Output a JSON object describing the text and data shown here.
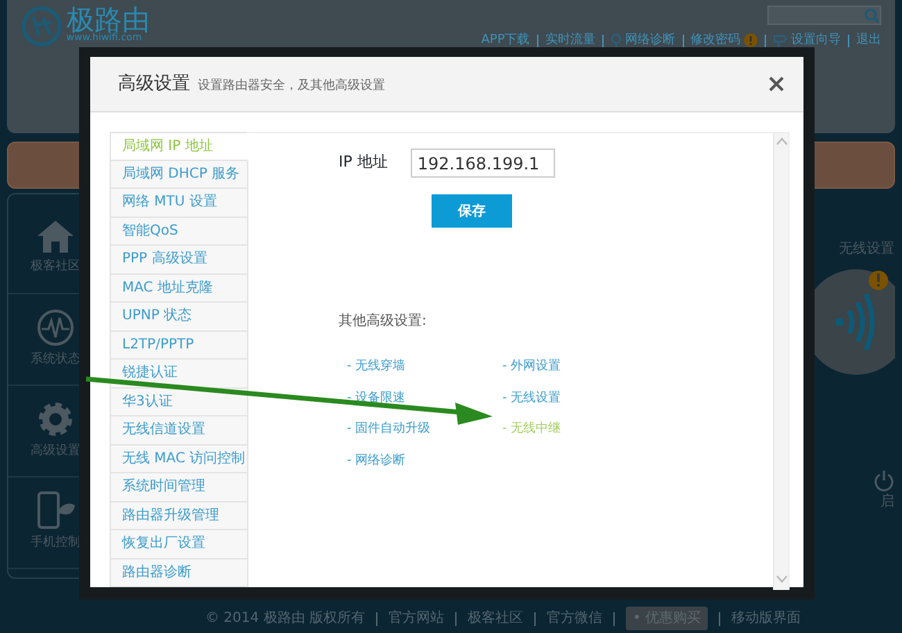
{
  "header": {
    "logo_name": "极路由",
    "logo_url": "www.hiwifi.com",
    "nav_links": [
      {
        "label": "APP下载",
        "kind": "plain"
      },
      {
        "label": "实时流量",
        "kind": "plain"
      },
      {
        "label": "网络诊断",
        "kind": "pin"
      },
      {
        "label": "修改密码",
        "kind": "alert"
      },
      {
        "label": "设置向导",
        "kind": "guide"
      },
      {
        "label": "退出",
        "kind": "plain"
      }
    ]
  },
  "sidebar": {
    "items": [
      {
        "label": "极客社区",
        "kind": "home"
      },
      {
        "label": "系统状态",
        "kind": "pulse"
      },
      {
        "label": "高级设置",
        "kind": "gear"
      },
      {
        "label": "手机控制",
        "kind": "phone"
      }
    ]
  },
  "right_panel": {
    "wireless_label": "无线设置",
    "restart_label": "启"
  },
  "modal": {
    "title": "高级设置",
    "subtitle": "设置路由器安全，及其他高级设置",
    "menu": [
      {
        "label": "局域网 IP 地址",
        "selected": true
      },
      {
        "label": "局域网 DHCP 服务",
        "selected": false
      },
      {
        "label": "网络 MTU 设置",
        "selected": false
      },
      {
        "label": "智能QoS",
        "selected": false
      },
      {
        "label": "PPP 高级设置",
        "selected": false
      },
      {
        "label": "MAC 地址克隆",
        "selected": false
      },
      {
        "label": "UPNP 状态",
        "selected": false
      },
      {
        "label": "L2TP/PPTP",
        "selected": false
      },
      {
        "label": "锐捷认证",
        "selected": false
      },
      {
        "label": "华3认证",
        "selected": false
      },
      {
        "label": "无线信道设置",
        "selected": false
      },
      {
        "label": "无线 MAC 访问控制",
        "selected": false
      },
      {
        "label": "系统时间管理",
        "selected": false
      },
      {
        "label": "路由器升级管理",
        "selected": false
      },
      {
        "label": "恢复出厂设置",
        "selected": false
      },
      {
        "label": "路由器诊断",
        "selected": false
      }
    ],
    "ip_label": "IP 地址",
    "ip_value": "192.168.199.1",
    "save_button": "保存",
    "other_title": "其他高级设置:",
    "other_links": [
      {
        "label": "- 无线穿墙",
        "selected": false
      },
      {
        "label": "- 外网设置",
        "selected": false
      },
      {
        "label": "- 设备限速",
        "selected": false
      },
      {
        "label": "- 无线设置",
        "selected": false
      },
      {
        "label": "- 固件自动升级",
        "selected": false
      },
      {
        "label": "- 无线中继",
        "selected": true
      },
      {
        "label": "- 网络诊断",
        "selected": false
      }
    ]
  },
  "footer": [
    {
      "label": "© 2014 极路由 版权所有",
      "kind": "text"
    },
    {
      "label": "官方网站",
      "kind": "link"
    },
    {
      "label": "极客社区",
      "kind": "link"
    },
    {
      "label": "官方微信",
      "kind": "link"
    },
    {
      "label": "• 优惠购买",
      "kind": "tag"
    },
    {
      "label": "移动版界面",
      "kind": "link"
    }
  ]
}
